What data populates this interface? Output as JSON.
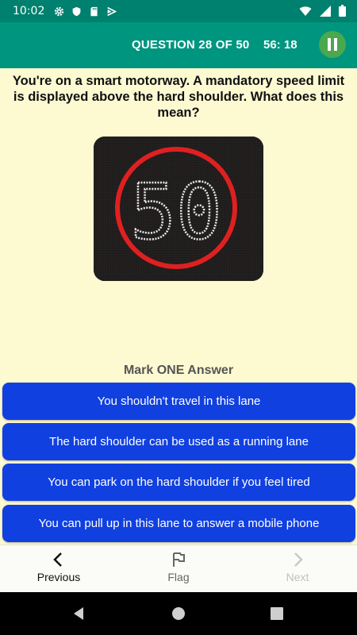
{
  "status_bar": {
    "time": "10:02",
    "left_icons": [
      "gear-icon",
      "shield-icon",
      "sd-card-icon",
      "cast-icon"
    ],
    "right_icons": [
      "wifi-icon",
      "signal-icon",
      "battery-icon"
    ]
  },
  "header": {
    "question_counter": "QUESTION 28 OF 50",
    "timer": "56: 18",
    "pause_icon": "pause-icon"
  },
  "question": {
    "text": "You're on a smart motorway. A mandatory speed limit is displayed above the hard shoulder. What does this mean?",
    "image": {
      "description_icon": "speed-limit-sign-icon",
      "sign_value": "50"
    }
  },
  "answers": {
    "label": "Mark ONE Answer",
    "options": [
      "You shouldn't travel in this lane",
      "The hard shoulder can be used as a running lane",
      "You can park on the hard shoulder if you feel tired",
      "You can pull up in this lane to answer a mobile phone"
    ]
  },
  "bottom_nav": {
    "previous_label": "Previous",
    "flag_label": "Flag",
    "next_label": "Next"
  },
  "colors": {
    "status_bar": "#00806e",
    "app_bar": "#00957f",
    "background": "#fdf9d1",
    "answer_button": "#1140e0",
    "pause_button": "#4aa84e",
    "sign_ring": "#e02020"
  }
}
